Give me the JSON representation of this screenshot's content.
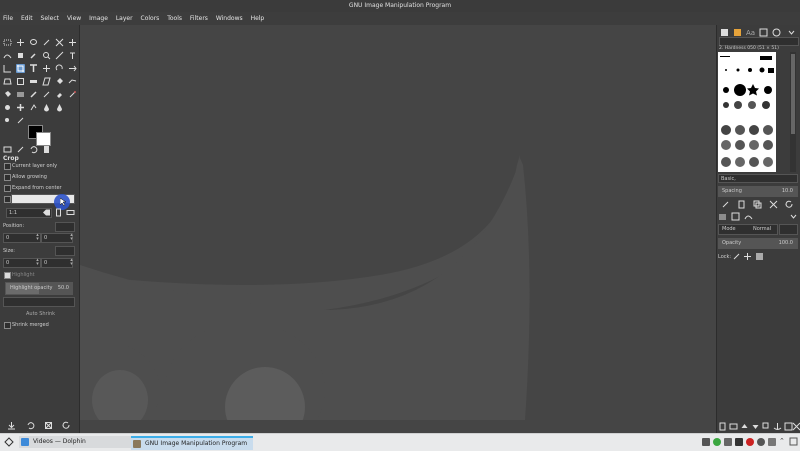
{
  "window": {
    "title": "GNU Image Manipulation Program"
  },
  "menu": [
    "File",
    "Edit",
    "Select",
    "View",
    "Image",
    "Layer",
    "Colors",
    "Tools",
    "Filters",
    "Windows",
    "Help"
  ],
  "tool_options": {
    "title": "Crop",
    "current_layer_only": "Current layer only",
    "allow_growing": "Allow growing",
    "expand_from_center": "Expand from center",
    "ratio_value": "1:1",
    "position_label": "Position:",
    "position_x": "0",
    "position_y": "0",
    "size_label": "Size:",
    "size_w": "0",
    "size_h": "0",
    "highlight": "Highlight",
    "highlight_opacity_label": "Highlight opacity",
    "highlight_opacity_value": "50.0",
    "auto_shrink": "Auto Shrink",
    "shrink_merged": "Shrink merged"
  },
  "brushes": {
    "name": "2. Hardness 050 (51 × 51)",
    "set": "Basic,",
    "spacing_label": "Spacing",
    "spacing_value": "10.0"
  },
  "layers": {
    "mode_label": "Mode",
    "mode_value": "Normal",
    "opacity_label": "Opacity",
    "opacity_value": "100.0",
    "lock_label": "Lock:"
  },
  "taskbar": {
    "items": [
      {
        "label": "Videos — Dolphin"
      },
      {
        "label": "GNU Image Manipulation Program"
      }
    ]
  },
  "colors": {
    "accent": "#6a9ad0",
    "background_dark": "#454545",
    "panel": "#3c3c3c",
    "taskbar": "#e9eaeb"
  }
}
